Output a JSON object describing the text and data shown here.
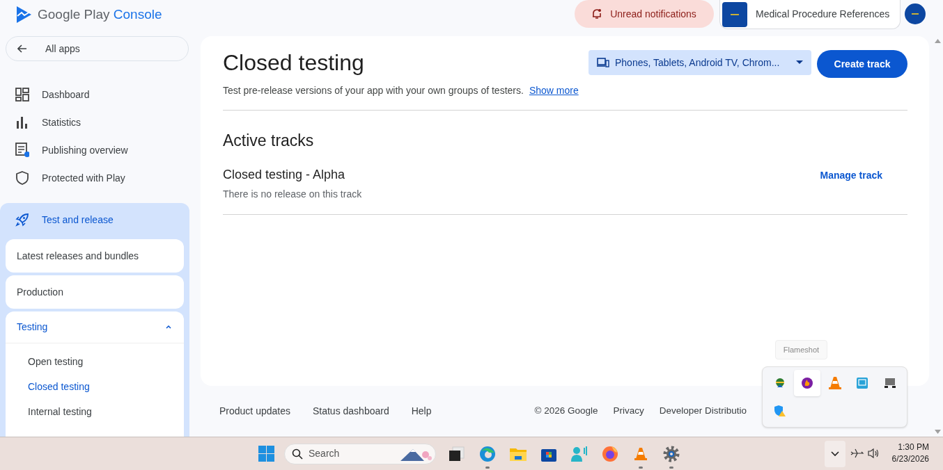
{
  "header": {
    "logo_text": "Google Play",
    "logo_accent": "Console",
    "notifications": "Unread notifications",
    "app_name": "Medical Procedure References"
  },
  "sidebar": {
    "back": "All apps",
    "items": [
      {
        "kind": "dashboard",
        "label": "Dashboard"
      },
      {
        "kind": "statistics",
        "label": "Statistics"
      },
      {
        "kind": "publishing",
        "label": "Publishing overview"
      },
      {
        "kind": "shield",
        "label": "Protected with Play"
      }
    ],
    "section": {
      "label": "Test and release",
      "items": [
        {
          "label": "Latest releases and bundles"
        },
        {
          "label": "Production"
        },
        {
          "label": "Testing",
          "expanded": true,
          "children": [
            {
              "label": "Open testing",
              "selected": false
            },
            {
              "label": "Closed testing",
              "selected": true
            },
            {
              "label": "Internal testing",
              "selected": false
            }
          ]
        }
      ]
    }
  },
  "main": {
    "title": "Closed testing",
    "subtitle": "Test pre-release versions of your app with your own groups of testers.",
    "show_more": "Show more",
    "device_selector": "Phones, Tablets, Android TV, Chrom...",
    "create_button": "Create track",
    "section_title": "Active tracks",
    "tracks": [
      {
        "name": "Closed testing - Alpha",
        "status": "There is no release on this track",
        "action": "Manage track"
      }
    ]
  },
  "footer": {
    "links": [
      "Product updates",
      "Status dashboard",
      "Help"
    ],
    "copyright": "© 2026 Google",
    "right_links": [
      "Privacy",
      "Developer Distributio"
    ]
  },
  "tray_popup": {
    "tooltip": "Flameshot",
    "icons": [
      {
        "kind": "download",
        "selected": false
      },
      {
        "kind": "flame",
        "selected": true
      },
      {
        "kind": "cone",
        "selected": false
      },
      {
        "kind": "monitor",
        "selected": false
      },
      {
        "kind": "display",
        "selected": false
      },
      {
        "kind": "shield-warning",
        "selected": false
      }
    ]
  },
  "taskbar": {
    "search_placeholder": "Search",
    "apps": [
      {
        "kind": "task-view",
        "running": false
      },
      {
        "kind": "edge",
        "running": true
      },
      {
        "kind": "folder",
        "running": false
      },
      {
        "kind": "store",
        "running": false
      },
      {
        "kind": "person",
        "running": false
      },
      {
        "kind": "firefox",
        "running": false
      },
      {
        "kind": "cone",
        "running": true
      },
      {
        "kind": "gear",
        "running": true
      }
    ],
    "time": "1:30 PM",
    "date": "6/23/2026"
  }
}
